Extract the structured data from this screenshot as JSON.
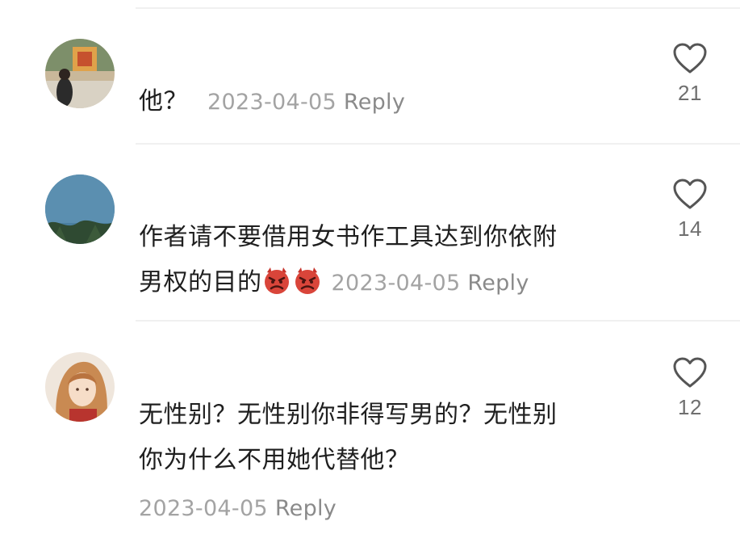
{
  "comments": [
    {
      "text": "他？",
      "date": "2023-04-05",
      "reply_label": "Reply",
      "likes": "21"
    },
    {
      "text_line1": "作者请不要借用女书作工具达到你依附",
      "text_line2": "男权的目的",
      "emojis": [
        "angry-devil-emoji",
        "angry-devil-emoji"
      ],
      "date": "2023-04-05",
      "reply_label": "Reply",
      "likes": "14"
    },
    {
      "text_line1": "无性别？无性别你非得写男的？无性别",
      "text_line2": "你为什么不用她代替他？",
      "date": "2023-04-05",
      "reply_label": "Reply",
      "likes": "12"
    }
  ],
  "icons": {
    "like": "heart-outline-icon"
  },
  "colors": {
    "text": "#1f1f1f",
    "meta": "#9a9a9a",
    "divider": "#f0f0f0",
    "icon": "#555555"
  }
}
